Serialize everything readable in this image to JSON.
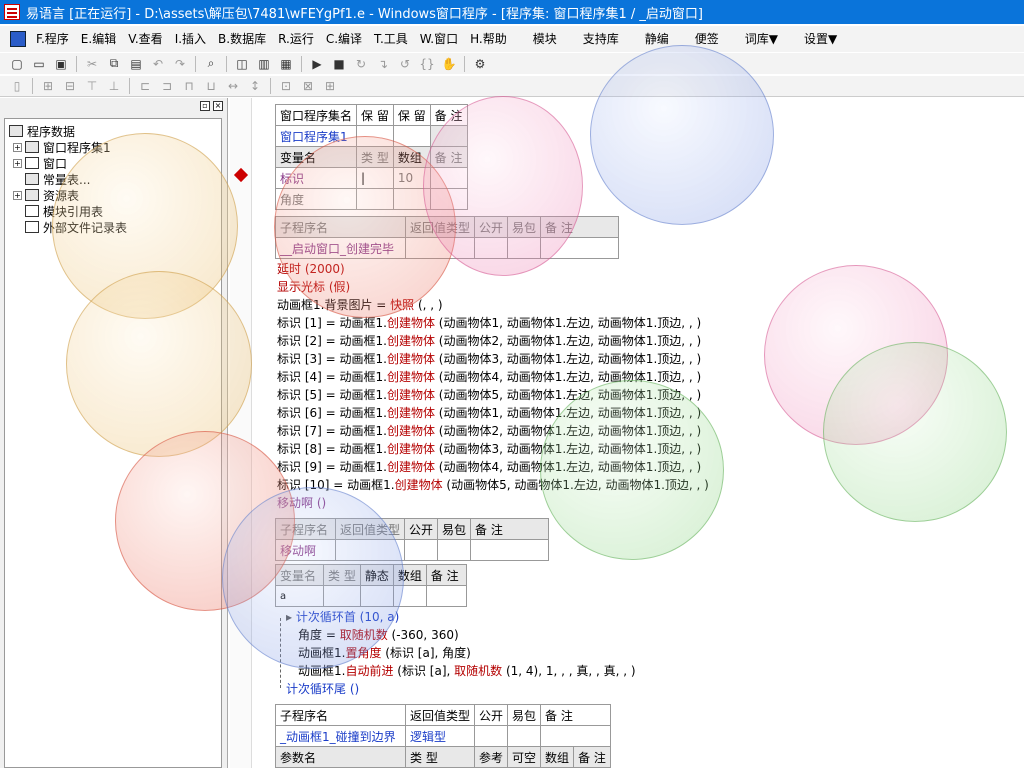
{
  "window": {
    "title": "易语言 [正在运行] - D:\\assets\\解压包\\7481\\wFEYgPf1.e - Windows窗口程序 - [程序集: 窗口程序集1 / _启动窗口]"
  },
  "menu": [
    "F.程序",
    "E.编辑",
    "V.查看",
    "I.插入",
    "B.数据库",
    "R.运行",
    "C.编译",
    "T.工具",
    "W.窗口",
    "H.帮助",
    "模块",
    "支持库",
    "静编",
    "便签",
    "词库▼",
    "设置▼"
  ],
  "toolbar1": [
    "new-file-icon",
    "open-folder-icon",
    "save-icon",
    "cut-icon",
    "copy-icon",
    "paste-icon",
    "undo-icon",
    "redo-icon",
    "find-icon",
    "layout1-icon",
    "layout2-icon",
    "layout3-icon",
    "run-icon",
    "stop-icon",
    "step-icon",
    "step-into-icon",
    "step-out-icon",
    "braces-icon",
    "hand-icon",
    "debug-icon"
  ],
  "toolbar2": [
    "align-left-icon",
    "align-center-icon",
    "align-right-icon",
    "align-top-icon",
    "align-middle-icon",
    "align-bottom-icon",
    "same-width-icon",
    "same-height-icon",
    "same-size-icon",
    "space-h-icon",
    "space-v-icon",
    "center-icon"
  ],
  "tree": {
    "root": "程序数据",
    "items": [
      "窗口程序集1",
      "窗口",
      "常量表...",
      "资源表",
      "模块引用表",
      "外部文件记录表"
    ]
  },
  "assembly_table": {
    "headers": [
      "窗口程序集名",
      "保 留",
      "保 留",
      "备 注"
    ],
    "name": "窗口程序集1",
    "var_headers": [
      "变量名",
      "类 型",
      "数组",
      "备 注"
    ],
    "vars": [
      {
        "name": "标识",
        "type": "",
        "array": "10",
        "note": ""
      },
      {
        "name": "角度",
        "type": "",
        "array": "",
        "note": ""
      }
    ]
  },
  "sub1": {
    "headers": [
      "子程序名",
      "返回值类型",
      "公开",
      "易包",
      "备 注"
    ],
    "name": "__启动窗口_创建完毕"
  },
  "code_lines": {
    "delay": "延时 (2000)",
    "cursor": "显示光标 (假)",
    "bg_obj": "动画框1",
    "bg_prop": ".背景图片 = ",
    "bg_func": "快照",
    "bg_args": " (, , )",
    "create_lines": [
      {
        "lhs": "标识 [1] = 动画框1.",
        "args": " (动画物体1, 动画物体1.左边, 动画物体1.顶边, , )"
      },
      {
        "lhs": "标识 [2] = 动画框1.",
        "args": " (动画物体2, 动画物体1.左边, 动画物体1.顶边, , )"
      },
      {
        "lhs": "标识 [3] = 动画框1.",
        "args": " (动画物体3, 动画物体1.左边, 动画物体1.顶边, , )"
      },
      {
        "lhs": "标识 [4] = 动画框1.",
        "args": " (动画物体4, 动画物体1.左边, 动画物体1.顶边, , )"
      },
      {
        "lhs": "标识 [5] = 动画框1.",
        "args": " (动画物体5, 动画物体1.左边, 动画物体1.顶边, , )"
      },
      {
        "lhs": "标识 [6] = 动画框1.",
        "args": " (动画物体1, 动画物体1.左边, 动画物体1.顶边, , )"
      },
      {
        "lhs": "标识 [7] = 动画框1.",
        "args": " (动画物体2, 动画物体1.左边, 动画物体1.顶边, , )"
      },
      {
        "lhs": "标识 [8] = 动画框1.",
        "args": " (动画物体3, 动画物体1.左边, 动画物体1.顶边, , )"
      },
      {
        "lhs": "标识 [9] = 动画框1.",
        "args": " (动画物体4, 动画物体1.左边, 动画物体1.顶边, , )"
      },
      {
        "lhs": "标识 [10] = 动画框1.",
        "args": " (动画物体5, 动画物体1.左边, 动画物体1.顶边, , )"
      }
    ],
    "create_func": "创建物体",
    "move_call": "移动啊 ()"
  },
  "sub2": {
    "headers": [
      "子程序名",
      "返回值类型",
      "公开",
      "易包",
      "备 注"
    ],
    "name": "移动啊",
    "var_headers": [
      "变量名",
      "类 型",
      "静态",
      "数组",
      "备 注"
    ],
    "var": "a"
  },
  "loop": {
    "head": "计次循环首 (10, a)",
    "l1_pre": "角度 = ",
    "l1_func": "取随机数",
    "l1_args": " (-360, 360)",
    "l2_pre": "动画框1.",
    "l2_func": "置角度",
    "l2_args": " (标识 [a], 角度)",
    "l3_pre": "动画框1.",
    "l3_func": "自动前进",
    "l3_mid": " (标识 [a], ",
    "l3_func2": "取随机数",
    "l3_args": " (1, 4), 1, , , 真, , 真, , )",
    "tail": "计次循环尾 ()"
  },
  "sub3": {
    "headers": [
      "子程序名",
      "返回值类型",
      "公开",
      "易包",
      "备 注"
    ],
    "name": "_动画框1_碰撞到边界",
    "ret": "逻辑型",
    "param_headers": [
      "参数名",
      "类 型",
      "参考",
      "可空",
      "数组",
      "备 注"
    ]
  },
  "colors": {
    "title": "#0a74da",
    "keyword": "#b40000",
    "name": "#1a3cc8"
  }
}
